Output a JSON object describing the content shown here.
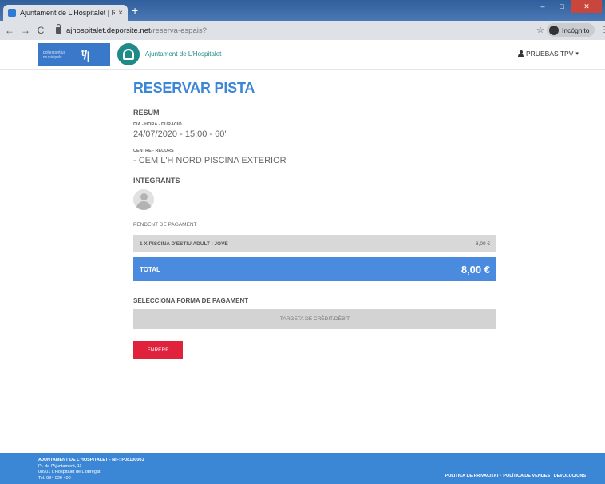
{
  "browser": {
    "tab_title": "Ajuntament de L'Hospitalet | Res",
    "tab_close": "×",
    "new_tab": "+",
    "url_domain": "ajhospitalet.deporsite.net",
    "url_path": "/reserva-espais?",
    "incognito_label": "Incógnito",
    "back": "←",
    "forward": "→",
    "reload": "C",
    "star": "☆",
    "menu": "⋮"
  },
  "header": {
    "logo1_text": "poliesportius municipals",
    "logo1_mark": "ᵗ/ꞁ",
    "brand": "Ajuntament de L'Hospitalet",
    "user_label": "PRUEBAS TPV"
  },
  "main": {
    "title": "RESERVAR PISTA",
    "resum_title": "RESUM",
    "dia_label": "DIA - HORA - DURACIÓ",
    "dia_value": "24/07/2020 - 15:00 - 60'",
    "centre_label": "CENTRE - RECURS",
    "centre_value": "- CEM L'H NORD PISCINA EXTERIOR",
    "integrants_title": "INTEGRANTS",
    "pending_label": "PENDENT DE PAGAMENT",
    "line_item": {
      "description": "1 X PISCINA D'ESTIU ADULT I JOVE",
      "price": "8,00 €"
    },
    "total": {
      "label": "TOTAL",
      "amount": "8,00 €"
    },
    "payment_title": "SELECCIONA FORMA DE PAGAMENT",
    "payment_option": "TARGETA DE CRÈDIT/DÈBIT",
    "back_button": "ENRERE"
  },
  "footer": {
    "line1": "AJUNTAMENT DE L'HOSPITALET - NIF: P0810000J",
    "line2": "Pl. de l'Ajuntament, 11",
    "line3": "08901 L'Hospitalet de Llobregat",
    "line4": "Tel. 934 029 400",
    "links": "POLITICA DE PRIVACITAT · POLÍTICA DE VENDES I DEVOLUCIONS"
  },
  "colors": {
    "accent": "#3c86d6",
    "danger": "#e0223c",
    "brand_teal": "#1f8a87"
  }
}
